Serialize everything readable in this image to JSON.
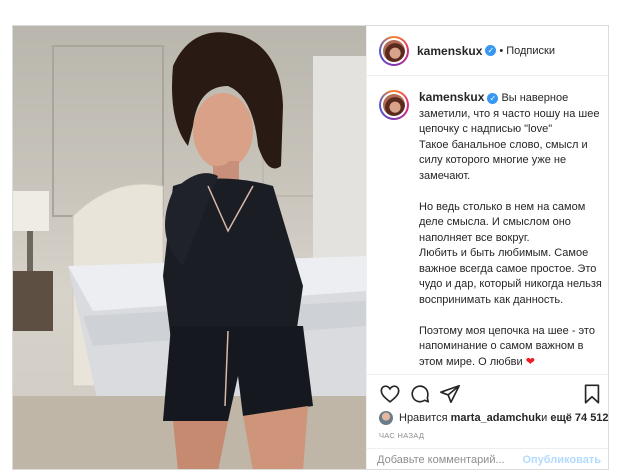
{
  "post": {
    "username": "kamenskux",
    "verified": true,
    "follow_label": "Подписки",
    "separator": "•",
    "caption_first": "Вы наверное заметили, что я часто ношу на шее цепочку с надписью \"love\"\nТакое банальное слово, смысл и силу которого многие уже не замечают.\n\nНо ведь столько в нем на самом деле смысла. И смыслом оно наполняет все вокруг.\nЛюбить и быть любимым. Самое важное всегда самое простое. Это чудо и дар, который никогда нельзя воспринимать как данность.\n\nПоэтому моя цепочка на шее - это напоминание о самом важном в этом мире. О любви ",
    "heart": "❤",
    "caption_more": ".",
    "likes_prefix": "Нравится ",
    "likes_user": "marta_adamchuk",
    "likes_middle": " и ",
    "likes_count": "ещё 74 512",
    "time_ago": "ЧАС НАЗАД",
    "comment_placeholder": "Добавьте комментарий...",
    "publish_label": "Опубликовать"
  },
  "icons": {
    "like": "heart-outline-icon",
    "comment": "comment-bubble-icon",
    "share": "paper-plane-icon",
    "save": "bookmark-icon"
  },
  "colors": {
    "verified": "#3897f0",
    "publish_disabled": "#b3dbff",
    "meta_gray": "#8e8e8e",
    "heart": "#ed1c24"
  }
}
